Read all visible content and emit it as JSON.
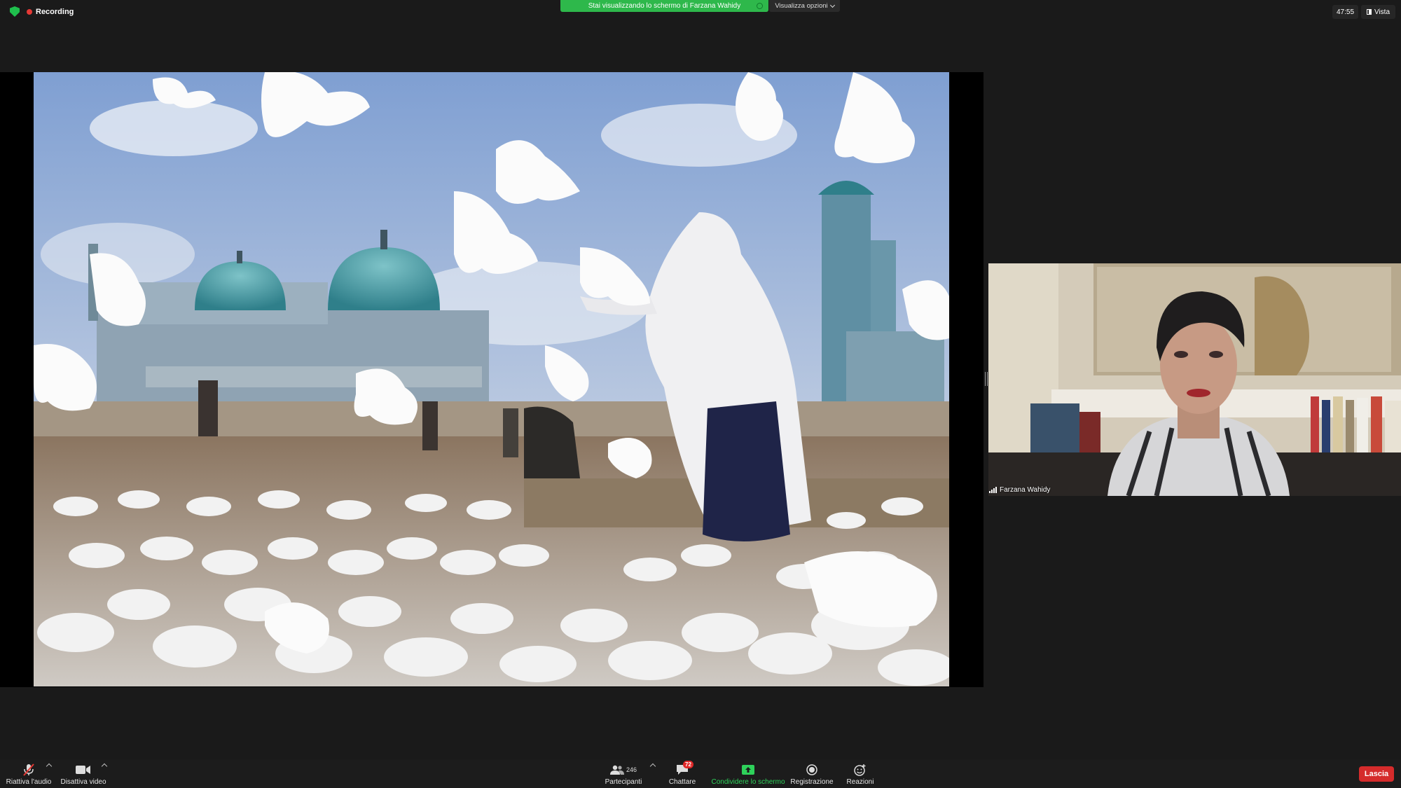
{
  "top": {
    "recording_label": "Recording",
    "share_banner": "Stai visualizzando lo schermo di Farzana Wahidy",
    "view_options": "Visualizza opzioni",
    "timer": "47:55",
    "view_label": "Vista"
  },
  "participant": {
    "name": "Farzana Wahidy"
  },
  "toolbar": {
    "unmute_label": "Riattiva l'audio",
    "video_label": "Disattiva video",
    "participants_label": "Partecipanti",
    "participants_count": "246",
    "chat_label": "Chattare",
    "chat_badge": "72",
    "share_label": "Condividere lo schermo",
    "record_label": "Registrazione",
    "reactions_label": "Reazioni",
    "leave_label": "Lascia"
  },
  "colors": {
    "share_green": "#2eb84b",
    "recording_red": "#e53935",
    "leave_red": "#d52b2b",
    "toolbar_bg": "#1c1c1c"
  },
  "icons": [
    "shield-icon",
    "recording-dot-icon",
    "vista-icon",
    "microphone-muted-icon",
    "video-camera-icon",
    "participants-icon",
    "chat-icon",
    "share-screen-icon",
    "record-icon",
    "reactions-icon",
    "signal-bars-icon"
  ]
}
